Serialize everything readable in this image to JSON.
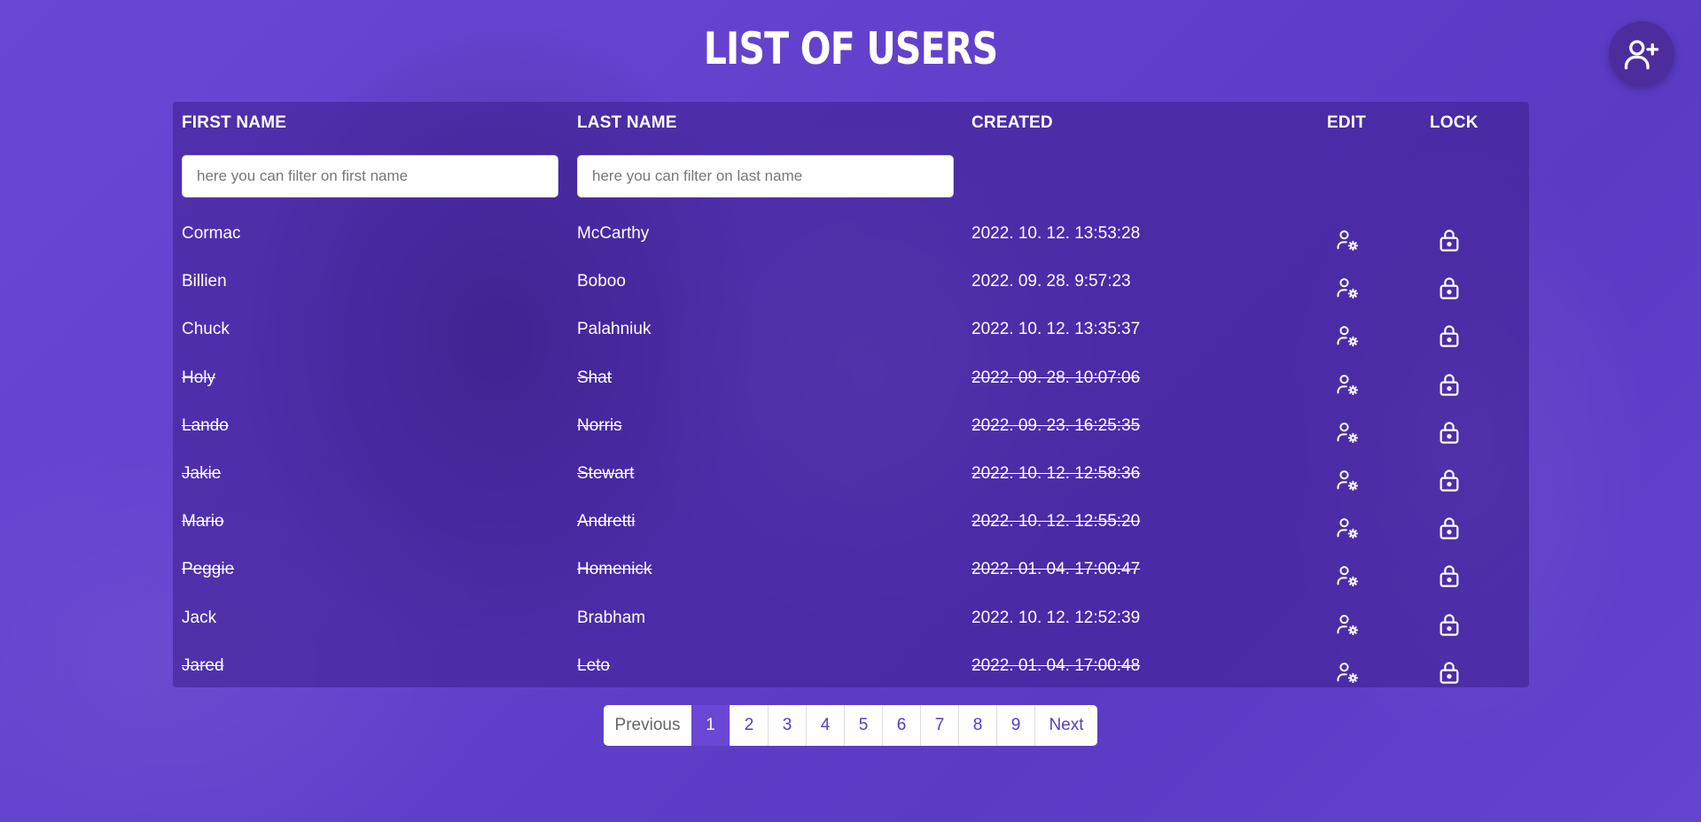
{
  "page": {
    "title": "LIST OF USERS"
  },
  "table": {
    "headers": {
      "first_name": "FIRST NAME",
      "last_name": "LAST NAME",
      "created": "CREATED",
      "edit": "EDIT",
      "lock": "LOCK"
    },
    "filters": {
      "first_name_placeholder": "here you can filter on first name",
      "last_name_placeholder": "here you can filter on last name"
    },
    "rows": [
      {
        "first": "Cormac",
        "last": "McCarthy",
        "created": "2022. 10. 12. 13:53:28",
        "locked": false
      },
      {
        "first": "Billien",
        "last": "Boboo",
        "created": "2022. 09. 28. 9:57:23",
        "locked": false
      },
      {
        "first": "Chuck",
        "last": "Palahniuk",
        "created": "2022. 10. 12. 13:35:37",
        "locked": false
      },
      {
        "first": "Holy",
        "last": "Shat",
        "created": "2022. 09. 28. 10:07:06",
        "locked": true
      },
      {
        "first": "Lando",
        "last": "Norris",
        "created": "2022. 09. 23. 16:25:35",
        "locked": true
      },
      {
        "first": "Jakie",
        "last": "Stewart",
        "created": "2022. 10. 12. 12:58:36",
        "locked": true
      },
      {
        "first": "Mario",
        "last": "Andretti",
        "created": "2022. 10. 12. 12:55:20",
        "locked": true
      },
      {
        "first": "Peggie",
        "last": "Homenick",
        "created": "2022. 01. 04. 17:00:47",
        "locked": true
      },
      {
        "first": "Jack",
        "last": "Brabham",
        "created": "2022. 10. 12. 12:52:39",
        "locked": false
      },
      {
        "first": "Jared",
        "last": "Leto",
        "created": "2022. 01. 04. 17:00:48",
        "locked": true
      }
    ]
  },
  "pagination": {
    "previous": "Previous",
    "next": "Next",
    "pages": [
      "1",
      "2",
      "3",
      "4",
      "5",
      "6",
      "7",
      "8",
      "9"
    ],
    "current": "1"
  },
  "icons": {
    "add_user": "user-plus-icon",
    "edit": "user-cog-icon",
    "lock": "lock-icon"
  },
  "colors": {
    "background": "#6444cf",
    "fab": "#4d2c9d",
    "active_page": "#6a47d4"
  }
}
